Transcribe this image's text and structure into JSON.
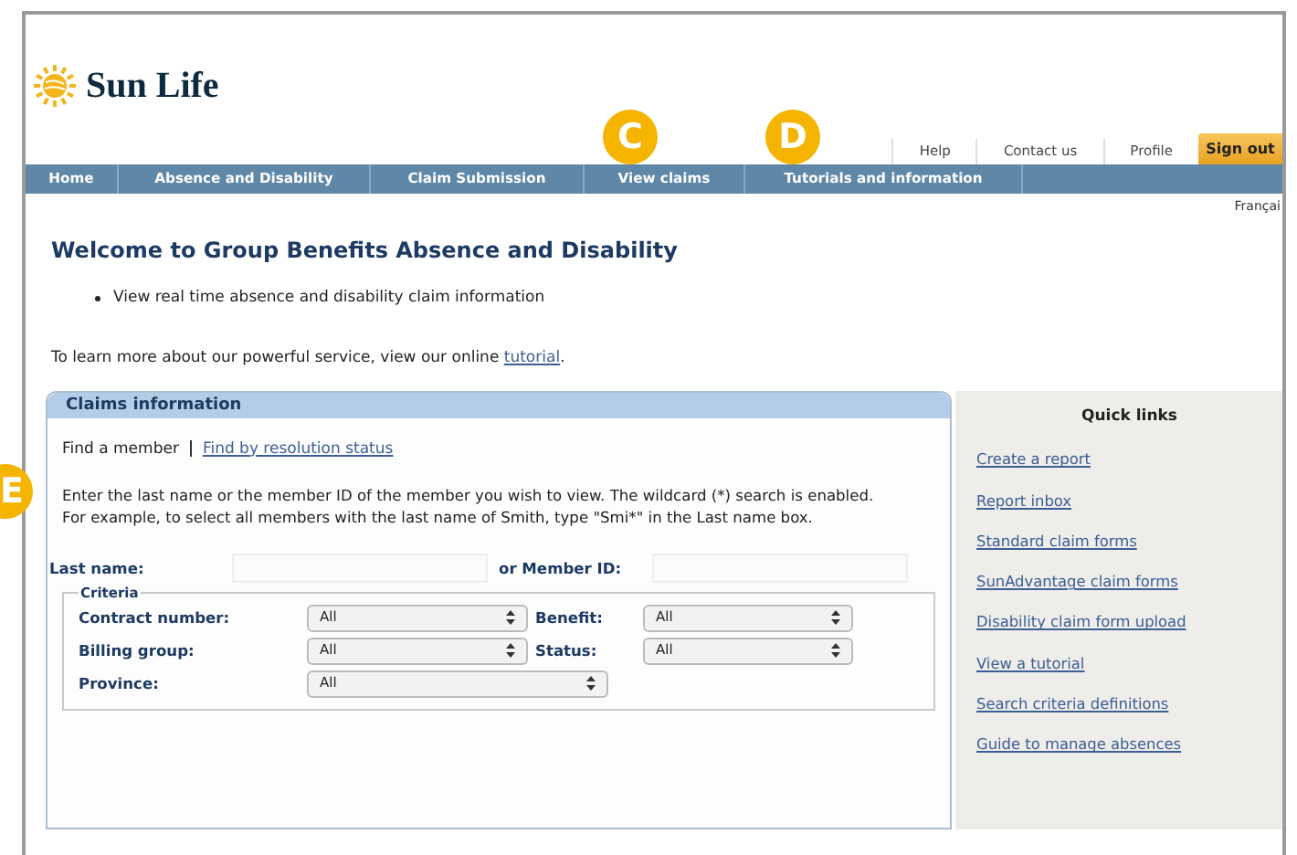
{
  "logo": {
    "text": "Sun Life"
  },
  "annotations": [
    {
      "label": "C"
    },
    {
      "label": "D"
    },
    {
      "label": "E"
    }
  ],
  "utility_links": [
    {
      "label": "Help",
      "kind": "link"
    },
    {
      "label": "Contact us",
      "kind": "link"
    },
    {
      "label": "Profile",
      "kind": "link"
    },
    {
      "label": "Sign out",
      "kind": "button"
    }
  ],
  "nav_tabs": [
    {
      "label": "Home"
    },
    {
      "label": "Absence and Disability"
    },
    {
      "label": "Claim Submission"
    },
    {
      "label": "View claims"
    },
    {
      "label": "Tutorials and information"
    }
  ],
  "language_link": "Françai",
  "welcome": {
    "title": "Welcome to Group Benefits Absence and Disability",
    "bullets": [
      "View real time absence and disability claim information"
    ],
    "intro": "To learn more about our powerful service, view our online ",
    "intro_link": "tutorial",
    "intro_end": "."
  },
  "claims_panel": {
    "title": "Claims information",
    "tabs": [
      {
        "label": "Find a member",
        "selected": true
      },
      {
        "label": "Find by resolution status",
        "selected": false
      }
    ],
    "instructions": "Enter the last name or the member ID of the member you wish to view. The wildcard (*) search is enabled. For example, to select all members with the last name of Smith, type \"Smi*\" in the Last name box.",
    "last_name_label": "Last name:",
    "member_id_label": "or Member ID:",
    "criteria": {
      "title": "Criteria",
      "fields": [
        {
          "label": "Contract number:",
          "value": "All"
        },
        {
          "label": "Benefit:",
          "value": "All"
        },
        {
          "label": "Billing group:",
          "value": "All"
        },
        {
          "label": "Status:",
          "value": "All"
        },
        {
          "label": "Province:",
          "value": "All"
        }
      ]
    }
  },
  "quick_links": {
    "title": "Quick links",
    "links": [
      "Create a report",
      "Report inbox",
      "Standard claim forms",
      "SunAdvantage claim forms",
      "Disability claim form upload",
      "View a tutorial",
      "Search criteria definitions",
      "Guide to manage absences"
    ]
  }
}
